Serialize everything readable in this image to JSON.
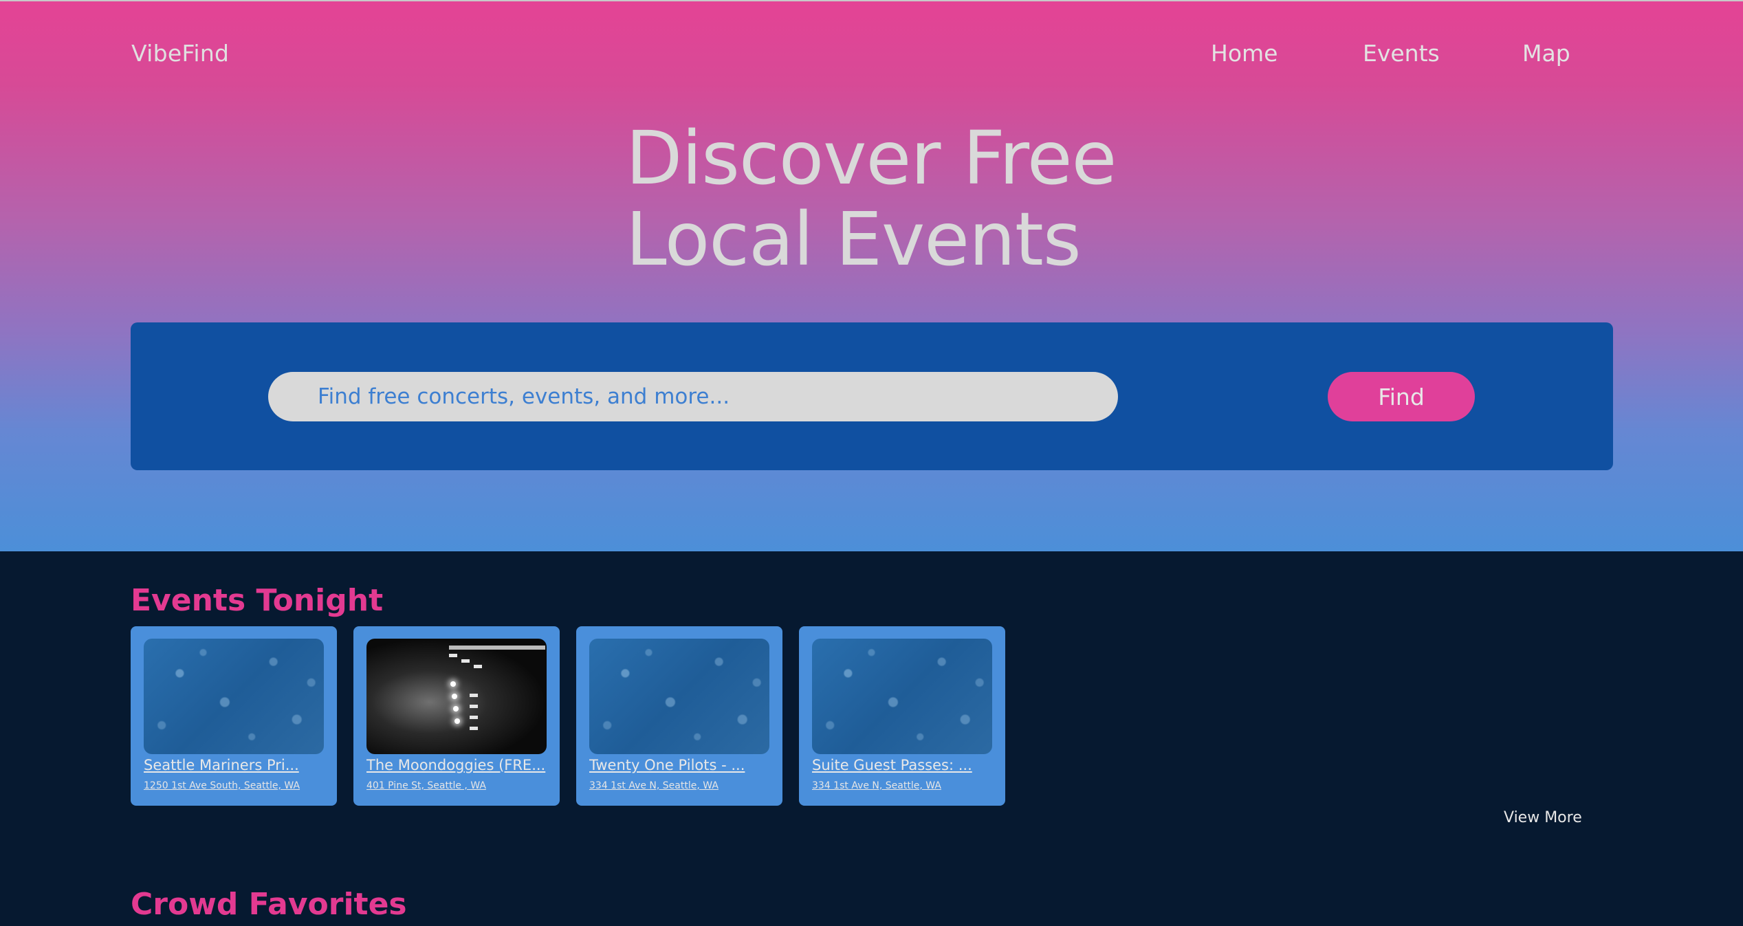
{
  "header": {
    "brand": "VibeFind",
    "nav": [
      "Home",
      "Events",
      "Map"
    ]
  },
  "hero": {
    "title_line1": "Discover Free",
    "title_line2": "Local Events"
  },
  "search": {
    "placeholder": "Find free concerts, events, and more...",
    "button_label": "Find"
  },
  "sections": {
    "tonight_title": "Events Tonight",
    "favorites_title": "Crowd Favorites",
    "view_more": "View More"
  },
  "events": [
    {
      "title": "Seattle Mariners Pri...",
      "address": "1250 1st Ave South, Seattle, WA",
      "image": "blue-bokeh"
    },
    {
      "title": "The Moondoggies (FRE...",
      "address": "401 Pine St, Seattle , WA",
      "image": "concert-stage"
    },
    {
      "title": "Twenty One Pilots - ...",
      "address": "334 1st Ave N, Seattle, WA",
      "image": "blue-bokeh"
    },
    {
      "title": "Suite Guest Passes: ...",
      "address": "334 1st Ave N, Seattle, WA",
      "image": "blue-bokeh"
    }
  ],
  "colors": {
    "accent_pink": "#e33a91",
    "panel_blue": "#1050a1",
    "card_blue": "#4a8fdb",
    "background_navy": "#061930"
  }
}
